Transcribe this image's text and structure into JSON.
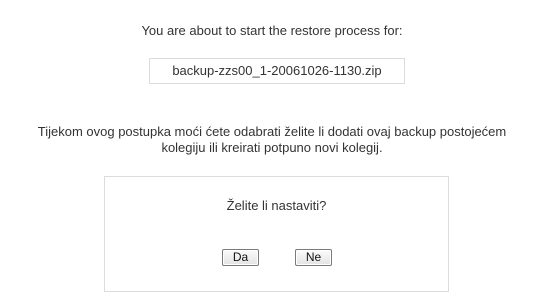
{
  "intro_text": "You are about to start the restore process for:",
  "filename": "backup-zzs00_1-20061026-1130.zip",
  "info": {
    "line1": "Tijekom ovog postupka moći ćete odabrati želite li dodati ovaj backup postojećem",
    "line2": "kolegiju ili kreirati potpuno novi kolegij."
  },
  "confirm": {
    "question": "Želite li nastaviti?",
    "yes_label": "Da",
    "no_label": "Ne"
  }
}
